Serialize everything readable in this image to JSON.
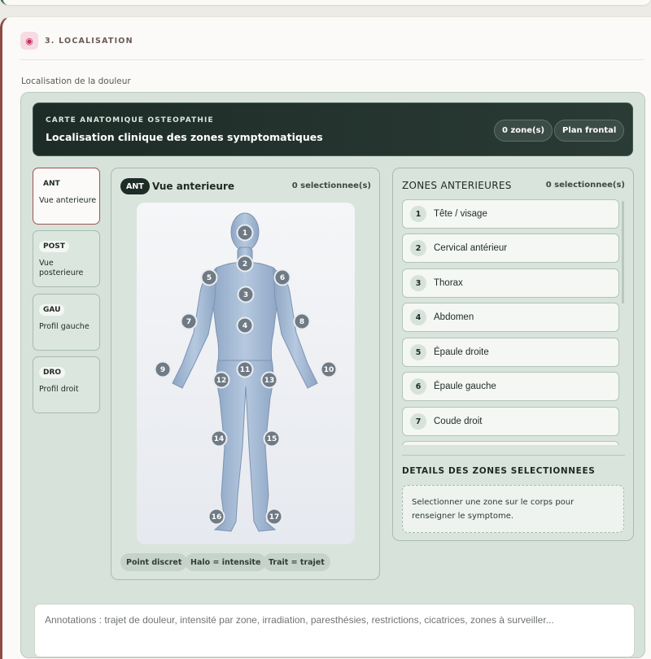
{
  "section": {
    "number_title": "3. LOCALISATION",
    "field_label": "Localisation de la douleur",
    "icon": "body-map-icon"
  },
  "banner": {
    "kicker": "CARTE ANATOMIQUE OSTEOPATHIE",
    "title": "Localisation clinique des zones symptomatiques",
    "zone_count": "0 zone(s)",
    "plane": "Plan frontal"
  },
  "views": [
    {
      "code": "ANT",
      "label": "Vue anterieure",
      "active": true
    },
    {
      "code": "POST",
      "label": "Vue posterieure",
      "active": false
    },
    {
      "code": "GAU",
      "label": "Profil gauche",
      "active": false
    },
    {
      "code": "DRO",
      "label": "Profil droit",
      "active": false
    }
  ],
  "body_panel": {
    "badge": "ANT",
    "title": "Vue anterieure",
    "count": "0 selectionnee(s)",
    "legend": [
      "Point discret",
      "Halo = intensite",
      "Trait = trajet"
    ],
    "markers": [
      "1",
      "2",
      "3",
      "4",
      "5",
      "6",
      "7",
      "8",
      "9",
      "10",
      "11",
      "12",
      "13",
      "14",
      "15",
      "16",
      "17"
    ]
  },
  "zones_panel": {
    "title": "ZONES ANTERIEURES",
    "count": "0 selectionnee(s)",
    "items": [
      {
        "num": "1",
        "label": "Tête / visage"
      },
      {
        "num": "2",
        "label": "Cervical antérieur"
      },
      {
        "num": "3",
        "label": "Thorax"
      },
      {
        "num": "4",
        "label": "Abdomen"
      },
      {
        "num": "5",
        "label": "Épaule droite"
      },
      {
        "num": "6",
        "label": "Épaule gauche"
      },
      {
        "num": "7",
        "label": "Coude droit"
      }
    ],
    "details_title": "DETAILS DES ZONES SELECTIONNEES",
    "details_text": "Selectionner une zone sur le corps pour renseigner le symptome."
  },
  "annotations": {
    "placeholder": "Annotations : trajet de douleur, intensité par zone, irradiation, paresthésies, restrictions, cicatrices, zones à surveiller..."
  }
}
